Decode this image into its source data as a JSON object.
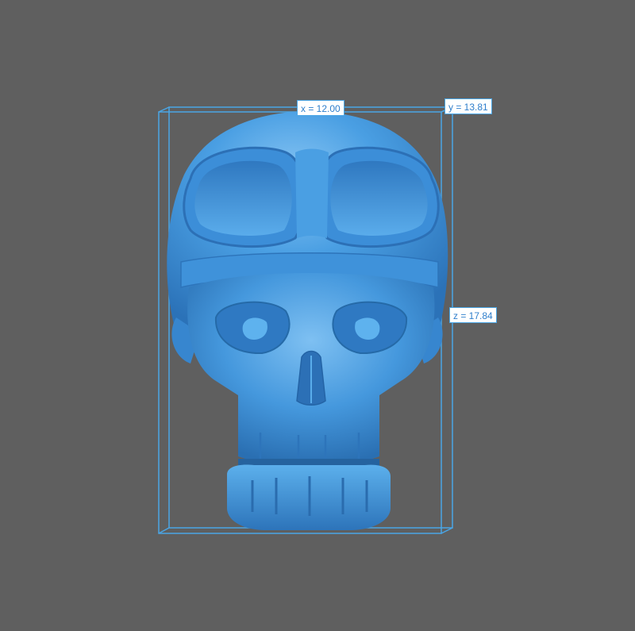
{
  "viewport": {
    "background_color": "#5f5f5f",
    "model_color": "#4a9fe3",
    "bbox_color": "#4aa6e6"
  },
  "model": {
    "name": "skull-with-aviator-helmet",
    "icon": "3d-model"
  },
  "dimensions": {
    "x_label": "x = 12.00",
    "y_label": "y = 13.81",
    "z_label": "z = 17.84"
  }
}
